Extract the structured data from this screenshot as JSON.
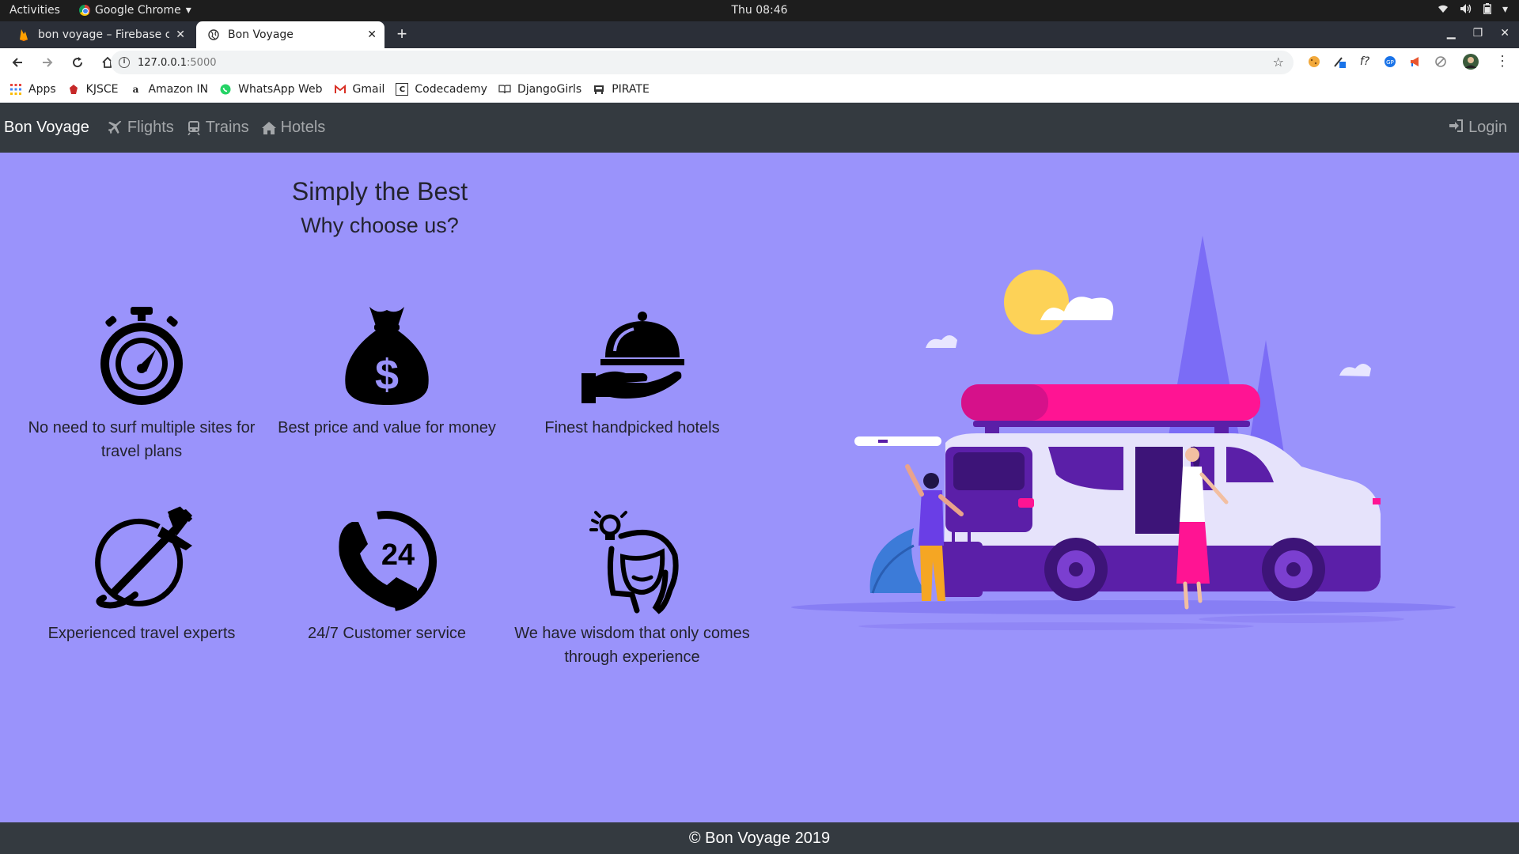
{
  "system_bar": {
    "activities": "Activities",
    "app_name": "Google Chrome",
    "clock": "Thu 08:46"
  },
  "tabs": [
    {
      "title": "bon voyage – Firebase cor",
      "icon": "firebase-flame-icon",
      "active": false
    },
    {
      "title": "Bon Voyage",
      "icon": "globe-icon",
      "active": true
    }
  ],
  "address_bar": {
    "host": "127.0.0.1",
    "port": ":5000"
  },
  "bookmarks": [
    {
      "label": "Apps",
      "icon": "apps-grid-icon"
    },
    {
      "label": "KJSCE",
      "icon": "kjsce-icon"
    },
    {
      "label": "Amazon IN",
      "icon": "amazon-icon"
    },
    {
      "label": "WhatsApp Web",
      "icon": "whatsapp-icon"
    },
    {
      "label": "Gmail",
      "icon": "gmail-icon"
    },
    {
      "label": "Codecademy",
      "icon": "codecademy-icon"
    },
    {
      "label": "DjangoGirls",
      "icon": "book-icon"
    },
    {
      "label": "PIRATE",
      "icon": "pirate-icon"
    }
  ],
  "site_nav": {
    "brand": "Bon Voyage",
    "links": [
      {
        "label": "Flights",
        "icon": "plane-icon"
      },
      {
        "label": "Trains",
        "icon": "train-icon"
      },
      {
        "label": "Hotels",
        "icon": "home-icon"
      }
    ],
    "login": "Login"
  },
  "hero": {
    "title": "Simply the Best",
    "subtitle": "Why choose us?"
  },
  "features": [
    {
      "text": "No need to surf multiple sites for travel plans",
      "icon": "stopwatch-icon"
    },
    {
      "text": "Best price and value for money",
      "icon": "money-bag-icon"
    },
    {
      "text": "Finest handpicked hotels",
      "icon": "serving-cloche-icon"
    },
    {
      "text": "Experienced travel experts",
      "icon": "plane-globe-icon"
    },
    {
      "text": "24/7 Customer service",
      "icon": "phone-24-icon",
      "badge": "24"
    },
    {
      "text": "We have wisdom that only comes through experience",
      "icon": "wisdom-head-icon"
    }
  ],
  "footer": {
    "text": "© Bon Voyage 2019"
  },
  "colors": {
    "page_background": "#9a93fb",
    "navbar": "#343a40",
    "accent_pink": "#ff1493",
    "accent_purple": "#5b1fa8"
  }
}
